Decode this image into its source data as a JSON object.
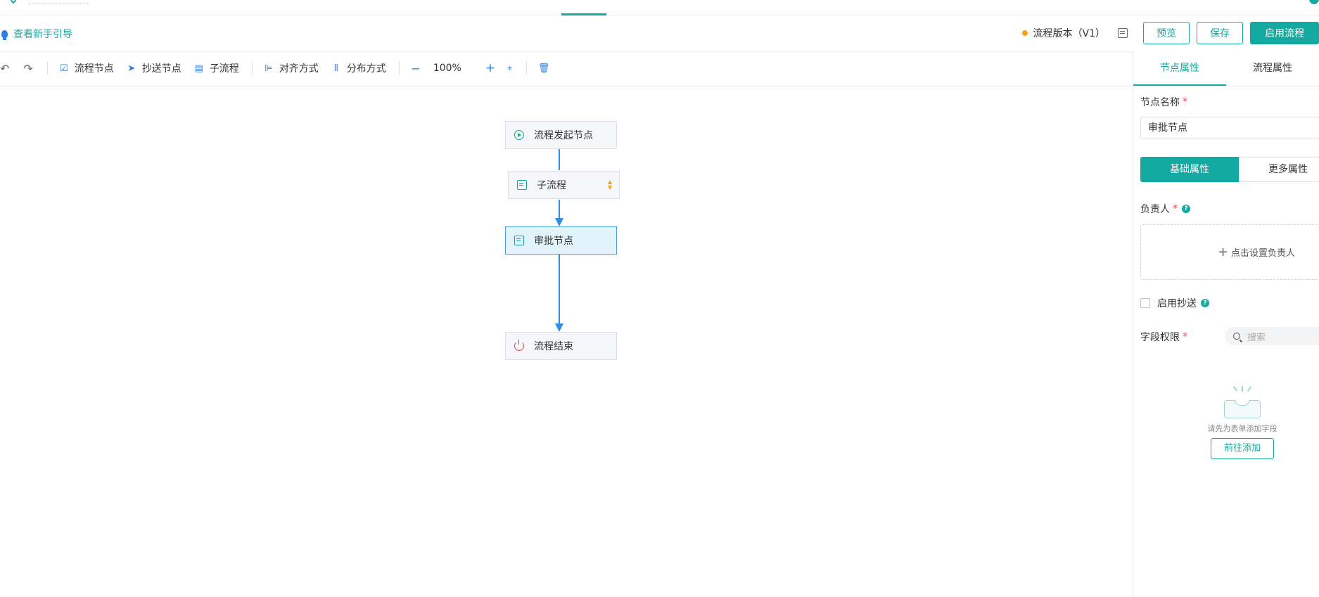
{
  "header": {
    "guide_text": "查看新手引导",
    "version_text": "流程版本（V1）",
    "preview_label": "预览",
    "save_label": "保存",
    "enable_label": "启用流程"
  },
  "toolbar": {
    "flow_node_label": "流程节点",
    "cc_node_label": "抄送节点",
    "subflow_label": "子流程",
    "align_label": "对齐方式",
    "distribute_label": "分布方式",
    "zoom_value": "100%"
  },
  "canvas": {
    "nodes": [
      {
        "label": "流程发起节点",
        "type": "start"
      },
      {
        "label": "子流程",
        "type": "subflow"
      },
      {
        "label": "审批节点",
        "type": "approval",
        "selected": true
      },
      {
        "label": "流程结束",
        "type": "end"
      }
    ]
  },
  "panel": {
    "tabs": [
      "节点属性",
      "流程属性"
    ],
    "node_name_label": "节点名称",
    "node_name_value": "审批节点",
    "seg_basic": "基础属性",
    "seg_more": "更多属性",
    "assignee_label": "负责人",
    "assignee_placeholder": "点击设置负责人",
    "cc_label": "启用抄送",
    "field_perm_label": "字段权限",
    "search_placeholder": "搜索",
    "empty_text": "请先为表单添加字段",
    "goto_add_label": "前往添加",
    "required_mark": "*",
    "help_mark": "?"
  },
  "colors": {
    "accent": "#14a9a0",
    "edge": "#2e8ee6",
    "version_dot": "#f7a213",
    "end_icon": "#e0474e"
  }
}
